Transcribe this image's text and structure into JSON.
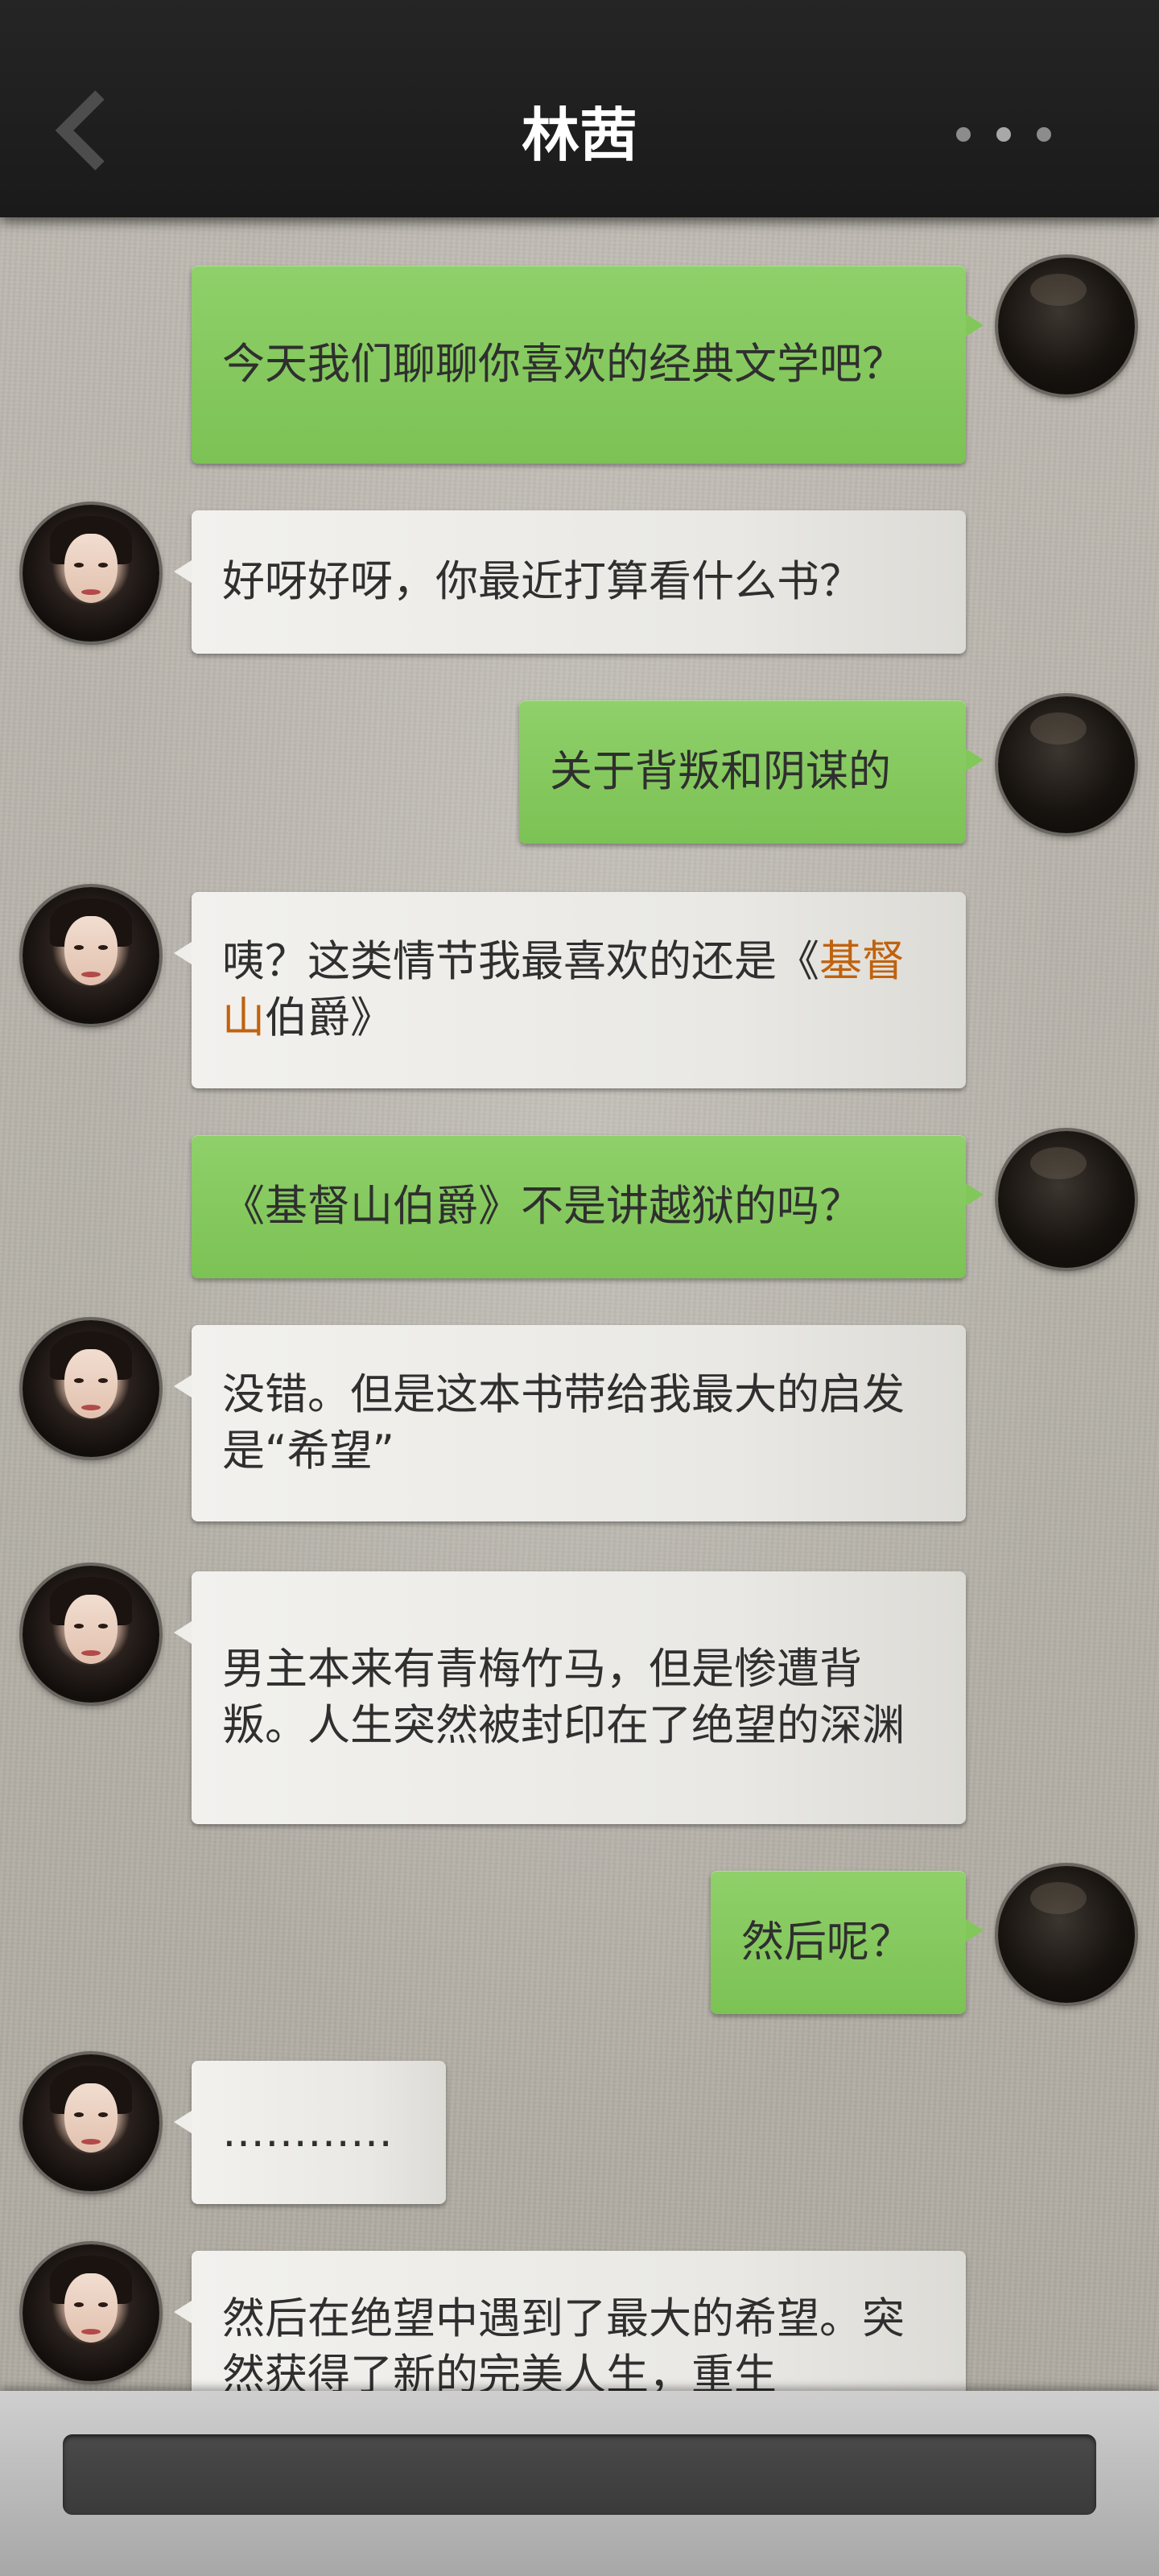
{
  "header": {
    "title": "林茜"
  },
  "messages": [
    {
      "side": "me",
      "text": "今天我们聊聊你喜欢的经典文学吧？"
    },
    {
      "side": "her",
      "text": "好呀好呀，你最近打算看什么书？"
    },
    {
      "side": "me",
      "text": "关于背叛和阴谋的"
    },
    {
      "side": "her",
      "text_before": "咦？这类情节我最喜欢的还是《",
      "highlight": "基督山",
      "text_after": "伯爵》"
    },
    {
      "side": "me",
      "text": "《基督山伯爵》不是讲越狱的吗？"
    },
    {
      "side": "her",
      "text": "没错。但是这本书带给我最大的启发是“希望”"
    },
    {
      "side": "her",
      "text": "男主本来有青梅竹马，但是惨遭背叛。人生突然被封印在了绝望的深渊"
    },
    {
      "side": "me",
      "text": "然后呢？"
    },
    {
      "side": "her",
      "text": "…………"
    },
    {
      "side": "her",
      "text": "然后在绝望中遇到了最大的希望。突然获得了新的完美人生，重生"
    }
  ],
  "colors": {
    "highlight": "#c0620e",
    "green_bubble": "#82c75a",
    "header": "#1e1e1e"
  }
}
